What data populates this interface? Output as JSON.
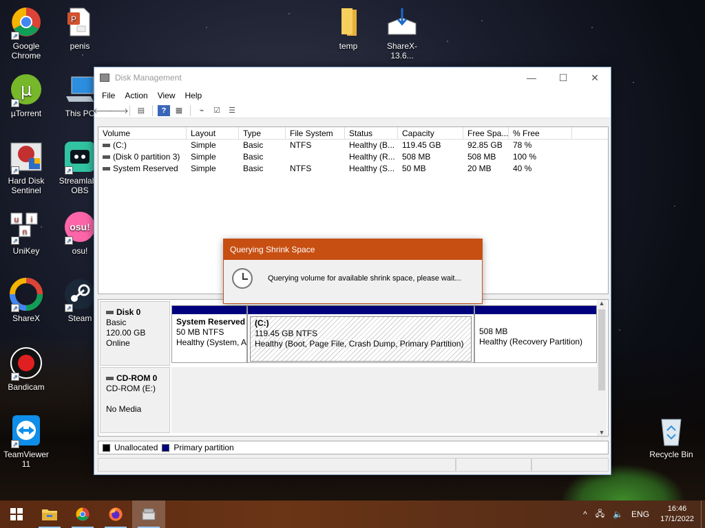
{
  "desktop": {
    "icons": [
      {
        "label": "Google Chrome"
      },
      {
        "label": "penis"
      },
      {
        "label": "temp"
      },
      {
        "label": "ShareX-13.6..."
      },
      {
        "label": "µTorrent"
      },
      {
        "label": "This PC"
      },
      {
        "label": "Hard Disk Sentinel"
      },
      {
        "label": "Streamlabs OBS"
      },
      {
        "label": "UniKey"
      },
      {
        "label": "osu!"
      },
      {
        "label": "ShareX"
      },
      {
        "label": "Steam"
      },
      {
        "label": "Bandicam"
      },
      {
        "label": "TeamViewer 11"
      },
      {
        "label": "Recycle Bin"
      }
    ],
    "icon_glyphs": {
      "osu": "osu!",
      "unikey_u": "u",
      "unikey_n": "n",
      "unikey_i": "i",
      "utorrent": "µ"
    }
  },
  "window": {
    "title": "Disk Management",
    "controls": {
      "minimize": "—",
      "maximize": "☐",
      "close": "✕"
    },
    "menu": [
      "File",
      "Action",
      "View",
      "Help"
    ],
    "toolbar_icons": [
      "back-icon",
      "forward-icon",
      "properties-icon",
      "help-icon",
      "view-icon",
      "connect-icon",
      "check-icon",
      "list-icon"
    ]
  },
  "volumes": {
    "columns": [
      "Volume",
      "Layout",
      "Type",
      "File System",
      "Status",
      "Capacity",
      "Free Spa...",
      "% Free"
    ],
    "rows": [
      [
        "(C:)",
        "Simple",
        "Basic",
        "NTFS",
        "Healthy (B...",
        "119.45 GB",
        "92.85 GB",
        "78 %"
      ],
      [
        "(Disk 0 partition 3)",
        "Simple",
        "Basic",
        "",
        "Healthy (R...",
        "508 MB",
        "508 MB",
        "100 %"
      ],
      [
        "System Reserved",
        "Simple",
        "Basic",
        "NTFS",
        "Healthy (S...",
        "50 MB",
        "20 MB",
        "40 %"
      ]
    ]
  },
  "disks": {
    "disk0": {
      "name": "Disk 0",
      "type": "Basic",
      "size": "120.00 GB",
      "state": "Online",
      "partitions": [
        {
          "name": "System Reserved",
          "size": "50 MB NTFS",
          "status": "Healthy (System, A"
        },
        {
          "name": "(C:)",
          "size": "119.45 GB NTFS",
          "status": "Healthy (Boot, Page File, Crash Dump, Primary Partition)"
        },
        {
          "name": "",
          "size": "508 MB",
          "status": "Healthy (Recovery Partition)"
        }
      ]
    },
    "cdrom0": {
      "name": "CD-ROM 0",
      "type": "CD-ROM (E:)",
      "media": "No Media"
    }
  },
  "legend": [
    {
      "label": "Unallocated",
      "color": "#000000"
    },
    {
      "label": "Primary partition",
      "color": "#00007f"
    }
  ],
  "dialog": {
    "title": "Querying Shrink Space",
    "message": "Querying volume for available shrink space, please wait..."
  },
  "taskbar": {
    "start": "start-icon",
    "apps": [
      "file-explorer-icon",
      "chrome-icon",
      "firefox-icon",
      "disk-management-icon"
    ],
    "tray": {
      "chevron": "^",
      "language": "ENG",
      "time": "16:46",
      "date": "17/1/2022"
    }
  },
  "colors": {
    "dialog_title": "#c74f12",
    "primary_partition": "#00007f",
    "taskbar": "#5a2a12"
  }
}
